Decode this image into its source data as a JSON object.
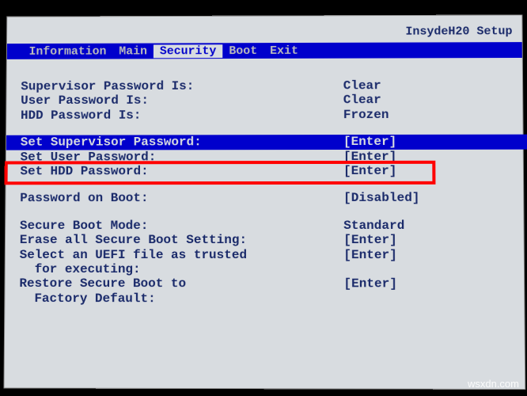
{
  "header": {
    "firmware_brand": "InsydeH20",
    "firmware_mode": "Setup"
  },
  "menu": {
    "items": [
      "Information",
      "Main",
      "Security",
      "Boot",
      "Exit"
    ],
    "active": "Security"
  },
  "security_page": {
    "supervisor_password_is": {
      "label": "Supervisor Password Is:",
      "value": "Clear"
    },
    "user_password_is": {
      "label": "User Password Is:",
      "value": "Clear"
    },
    "hdd_password_is": {
      "label": "HDD Password Is:",
      "value": "Frozen"
    },
    "set_supervisor_password": {
      "label": "Set Supervisor Password:",
      "value": "[Enter]"
    },
    "set_user_password": {
      "label": "Set User Password:",
      "value": "[Enter]"
    },
    "set_hdd_password": {
      "label": "Set HDD Password:",
      "value": "[Enter]"
    },
    "password_on_boot": {
      "label": "Password on Boot:",
      "value": "[Disabled]"
    },
    "secure_boot_mode": {
      "label": "Secure Boot Mode:",
      "value": "Standard"
    },
    "erase_secure_boot": {
      "label": "Erase all Secure Boot Setting:",
      "value": "[Enter]"
    },
    "select_uefi_file": {
      "label": "Select an UEFI file as trusted\n  for executing:",
      "value": "[Enter]"
    },
    "restore_secure_boot": {
      "label": "Restore Secure Boot to\n  Factory Default:",
      "value": "[Enter]"
    }
  },
  "watermark": "wsxdn.com"
}
